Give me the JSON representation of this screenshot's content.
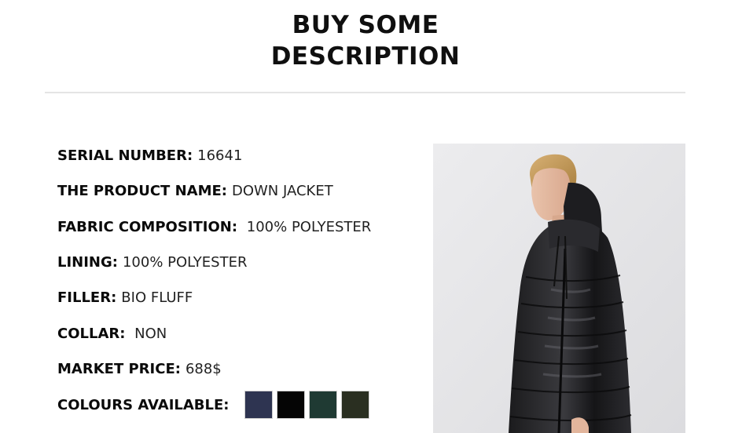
{
  "header": {
    "title_line1": "BUY SOME",
    "title_line2": "DESCRIPTION"
  },
  "specs": [
    {
      "label": "SERIAL NUMBER:",
      "value": "16641"
    },
    {
      "label": "THE PRODUCT NAME:",
      "value": "DOWN JACKET"
    },
    {
      "label": "FABRIC COMPOSITION:",
      "value": " 100% POLYESTER"
    },
    {
      "label": "LINING:",
      "value": "100% POLYESTER"
    },
    {
      "label": "FILLER:",
      "value": "BIO FLUFF"
    },
    {
      "label": "COLLAR:",
      "value": " NON"
    },
    {
      "label": "MARKET PRICE:",
      "value": "688$"
    }
  ],
  "colours": {
    "label": "COLOURS AVAILABLE:",
    "swatches": [
      {
        "name": "navy",
        "hex": "#2e3451"
      },
      {
        "name": "black",
        "hex": "#050505"
      },
      {
        "name": "dark-green",
        "hex": "#1f3a33"
      },
      {
        "name": "dark-olive",
        "hex": "#2a2f21"
      }
    ]
  },
  "colors": {
    "background": "#ffffff",
    "divider": "#e4e4e4",
    "text": "#111111"
  }
}
